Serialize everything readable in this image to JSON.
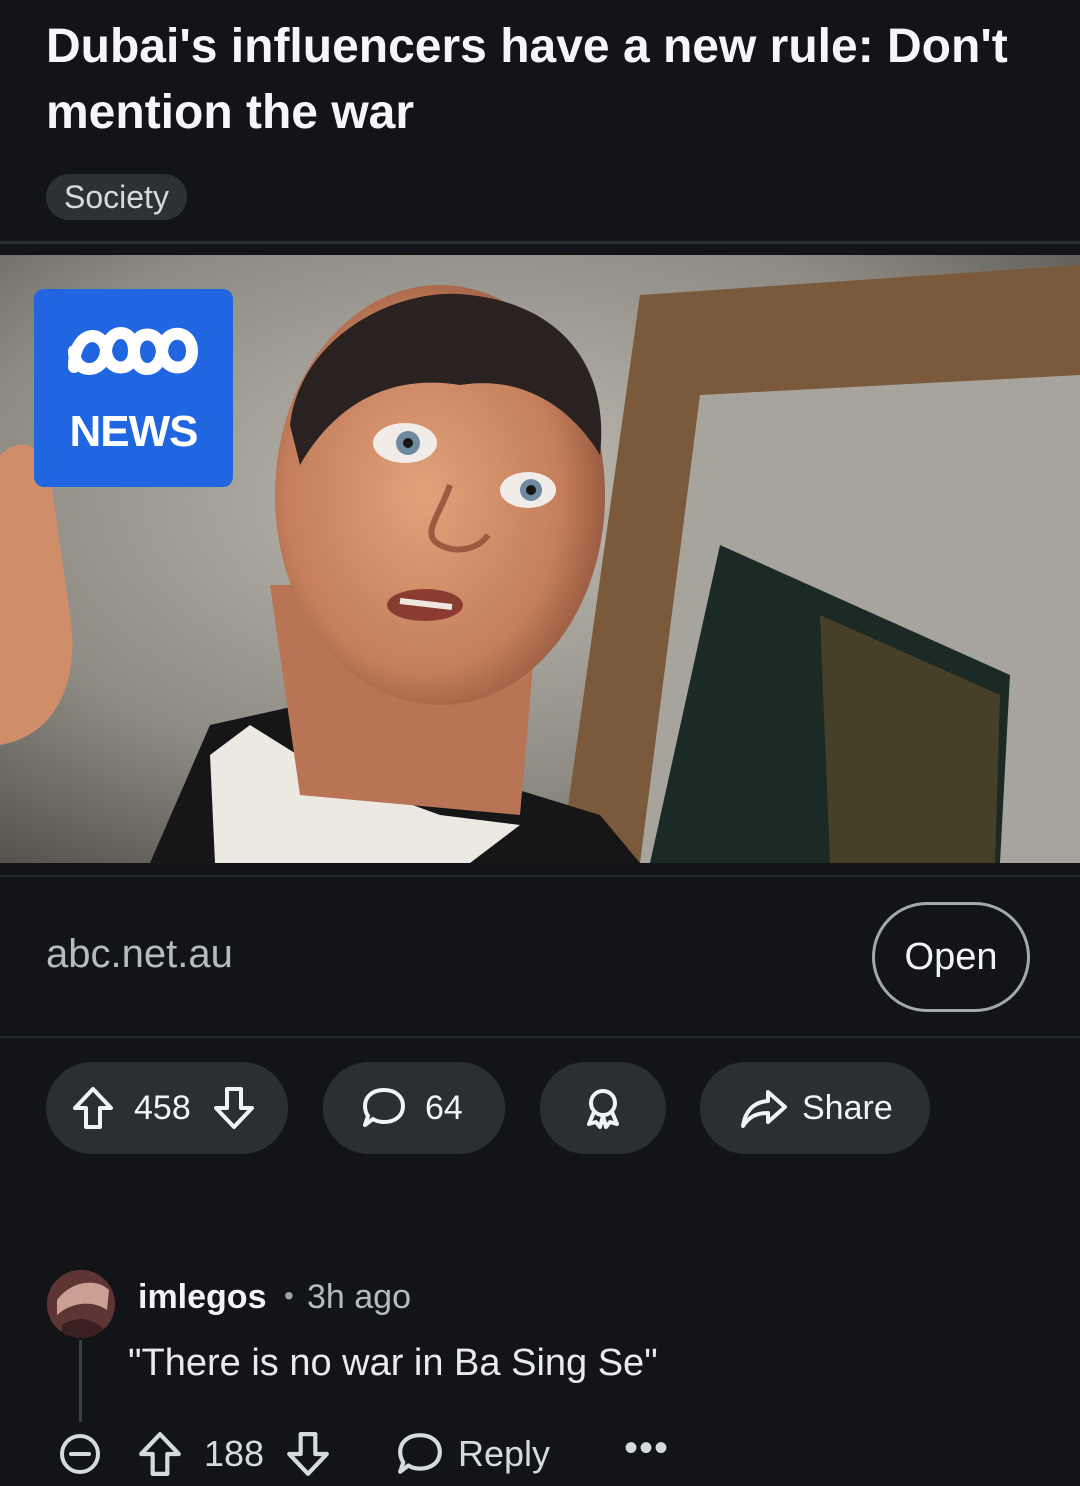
{
  "post": {
    "title": "Dubai's influencers have a new rule: Don't mention the war",
    "flair": "Society",
    "image_logo_text": "NEWS",
    "domain": "abc.net.au",
    "open_label": "Open"
  },
  "actions": {
    "score": "458",
    "comments": "64",
    "share_label": "Share"
  },
  "comment": {
    "username": "imlegos",
    "separator": "•",
    "time": "3h ago",
    "text": "\"There is no war in Ba Sing Se\"",
    "score": "188",
    "reply_label": "Reply",
    "more_label": "•••"
  },
  "colors": {
    "background": "#121418",
    "pill": "#2b2f34",
    "abc_blue": "#1f66e0"
  }
}
